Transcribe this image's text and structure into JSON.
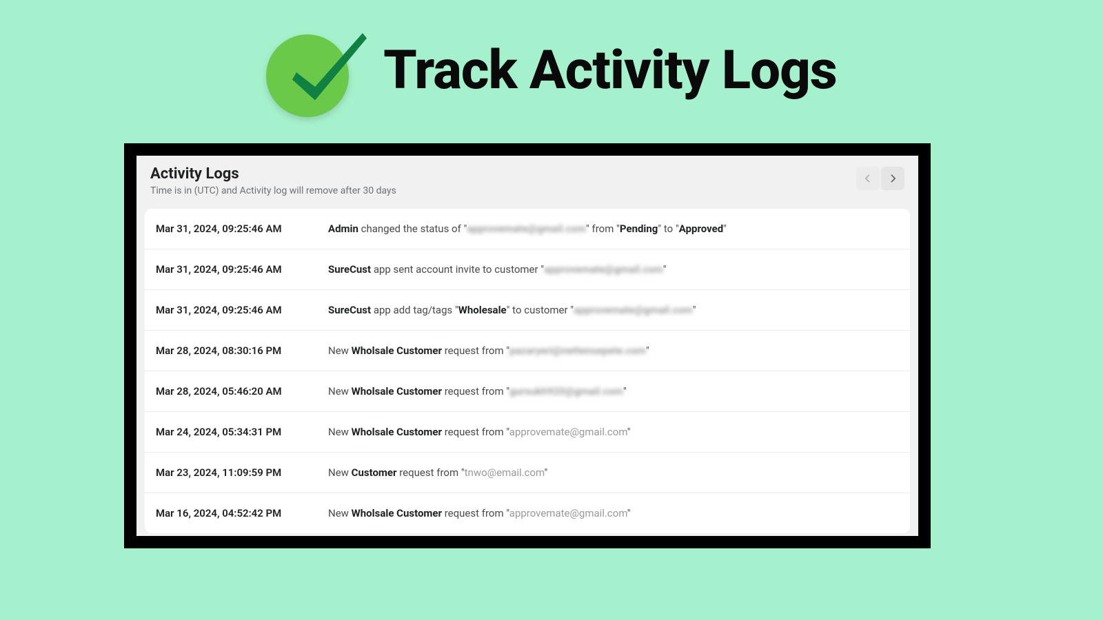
{
  "hero": {
    "title": "Track Activity Logs"
  },
  "panel": {
    "title": "Activity Logs",
    "subtitle": "Time is in (UTC) and Activity log will remove after 30 days"
  },
  "rows": [
    {
      "ts": "Mar 31, 2024, 09:25:46 AM",
      "parts": [
        {
          "t": "Admin",
          "bold": true
        },
        {
          "t": " changed the status of \""
        },
        {
          "t": "approvemate@gmail.com",
          "blur": true
        },
        {
          "t": "\" from \""
        },
        {
          "t": "Pending",
          "bold": true
        },
        {
          "t": "\" to \""
        },
        {
          "t": "Approved",
          "bold": true
        },
        {
          "t": "\""
        }
      ]
    },
    {
      "ts": "Mar 31, 2024, 09:25:46 AM",
      "parts": [
        {
          "t": "SureCust",
          "bold": true
        },
        {
          "t": " app sent account invite to customer \""
        },
        {
          "t": "approvemate@gmail.com",
          "blur": true
        },
        {
          "t": "\""
        }
      ]
    },
    {
      "ts": "Mar 31, 2024, 09:25:46 AM",
      "parts": [
        {
          "t": "SureCust",
          "bold": true
        },
        {
          "t": " app add tag/tags \""
        },
        {
          "t": "Wholesale",
          "bold": true
        },
        {
          "t": "\" to customer \""
        },
        {
          "t": "approvemate@gmail.com",
          "blur": true
        },
        {
          "t": "\""
        }
      ]
    },
    {
      "ts": "Mar 28, 2024, 08:30:16 PM",
      "parts": [
        {
          "t": "New "
        },
        {
          "t": "Wholsale Customer",
          "bold": true
        },
        {
          "t": " request from \""
        },
        {
          "t": "pazaryeri@nettensepete.com",
          "blur": true
        },
        {
          "t": "\""
        }
      ]
    },
    {
      "ts": "Mar 28, 2024, 05:46:20 AM",
      "parts": [
        {
          "t": "New "
        },
        {
          "t": "Wholsale Customer",
          "bold": true
        },
        {
          "t": " request from \""
        },
        {
          "t": "gursukh920@gmail.com",
          "blur": true
        },
        {
          "t": "\""
        }
      ]
    },
    {
      "ts": "Mar 24, 2024, 05:34:31 PM",
      "parts": [
        {
          "t": "New "
        },
        {
          "t": "Wholsale Customer",
          "bold": true
        },
        {
          "t": " request from \""
        },
        {
          "t": "approvemate@gmail.com",
          "dim": true
        },
        {
          "t": "\""
        }
      ]
    },
    {
      "ts": "Mar 23, 2024, 11:09:59 PM",
      "parts": [
        {
          "t": "New "
        },
        {
          "t": "Customer",
          "bold": true
        },
        {
          "t": " request from \""
        },
        {
          "t": "tnwo@email.com",
          "dim": true
        },
        {
          "t": "\""
        }
      ]
    },
    {
      "ts": "Mar 16, 2024, 04:52:42 PM",
      "parts": [
        {
          "t": "New "
        },
        {
          "t": "Wholsale Customer",
          "bold": true
        },
        {
          "t": " request from \""
        },
        {
          "t": "approvemate@gmail.com",
          "dim": true
        },
        {
          "t": "\""
        }
      ]
    }
  ]
}
